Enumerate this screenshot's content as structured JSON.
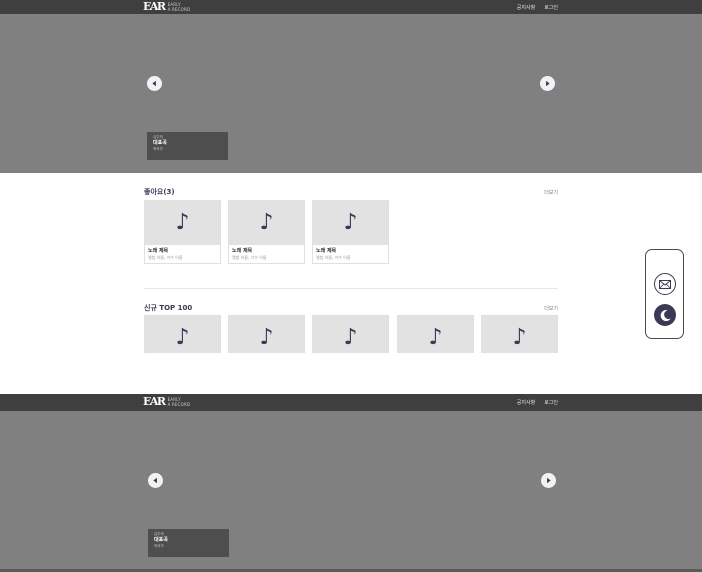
{
  "header": {
    "logo_big": "EAR",
    "logo_small_1": "EARLY",
    "logo_small_2": "A RECORD",
    "notice_label": "공지사항",
    "login_label": "로그인"
  },
  "hero": {
    "caption_line1": "금주의",
    "caption_line2": "대표곡",
    "caption_line3": "작곡가"
  },
  "hero2": {
    "caption_line1": "금주의",
    "caption_line2": "대표곡",
    "caption_line3": "작곡가"
  },
  "likes": {
    "title": "좋아요(3)",
    "more_label": "더보기",
    "items": [
      {
        "title": "노래 제목",
        "meta": "앨범 이름, 가수 이름"
      },
      {
        "title": "노래 제목",
        "meta": "앨범 이름, 가수 이름"
      },
      {
        "title": "노래 제목",
        "meta": "앨범 이름, 가수 이름"
      }
    ]
  },
  "new_top": {
    "title": "신규 TOP 100",
    "more_label": "더보기",
    "count": 5
  },
  "icons": {
    "note": "♪",
    "mail": "mail-icon",
    "moon": "moon-icon"
  }
}
